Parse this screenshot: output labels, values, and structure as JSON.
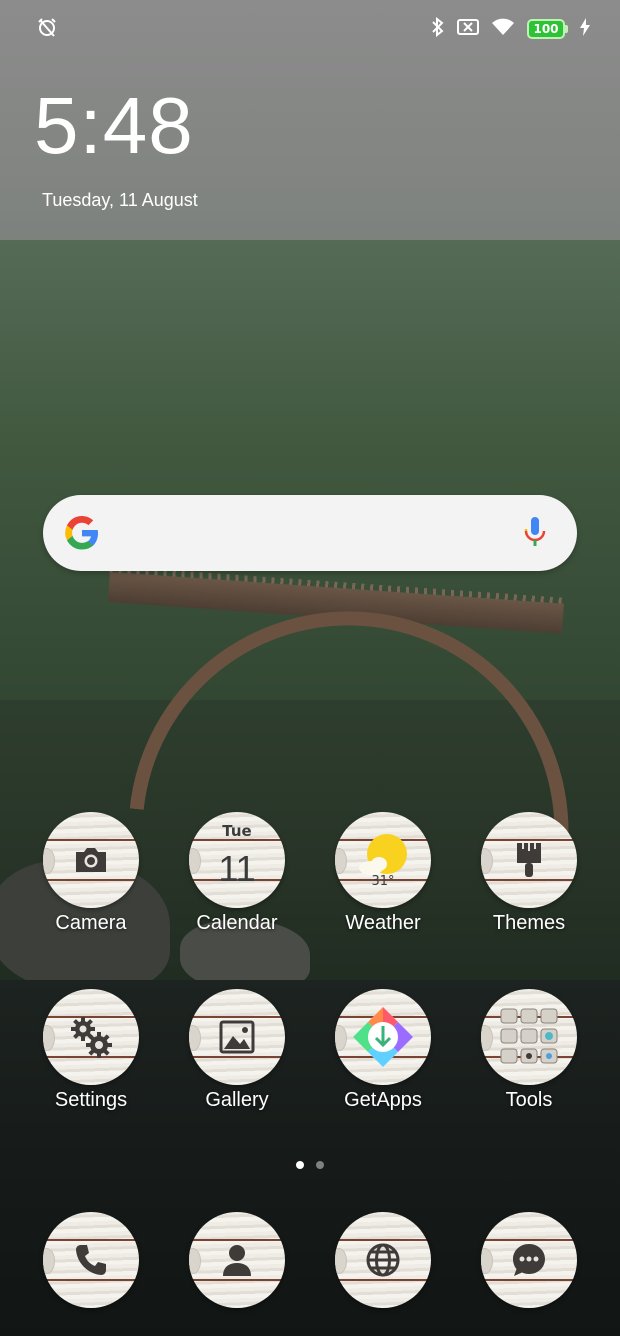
{
  "status_bar": {
    "left_icons": [
      "alarm-off-icon"
    ],
    "right_icons": [
      "bluetooth-icon",
      "sim-none-icon",
      "wifi-icon"
    ],
    "battery_level": "100",
    "charging": true,
    "battery_color": "#2ec236"
  },
  "clock": {
    "time": "5:48",
    "date": "Tuesday, 11 August"
  },
  "search": {
    "logo": "google-g-icon",
    "mic": "mic-icon"
  },
  "apps": {
    "row1": [
      {
        "label": "Camera",
        "icon": "camera-icon"
      },
      {
        "label": "Calendar",
        "icon": "calendar-icon",
        "day": "Tue",
        "date": "11"
      },
      {
        "label": "Weather",
        "icon": "weather-sun-cloud-icon",
        "temp": "31°"
      },
      {
        "label": "Themes",
        "icon": "paintbrush-icon"
      }
    ],
    "row2": [
      {
        "label": "Settings",
        "icon": "gears-icon"
      },
      {
        "label": "Gallery",
        "icon": "image-icon"
      },
      {
        "label": "GetApps",
        "icon": "getapps-icon"
      },
      {
        "label": "Tools",
        "icon": "tools-folder-icon"
      }
    ]
  },
  "page_indicator": {
    "pages": 2,
    "current": 1
  },
  "dock": [
    {
      "icon": "phone-icon"
    },
    {
      "icon": "contacts-icon"
    },
    {
      "icon": "browser-globe-icon"
    },
    {
      "icon": "messages-icon"
    }
  ]
}
